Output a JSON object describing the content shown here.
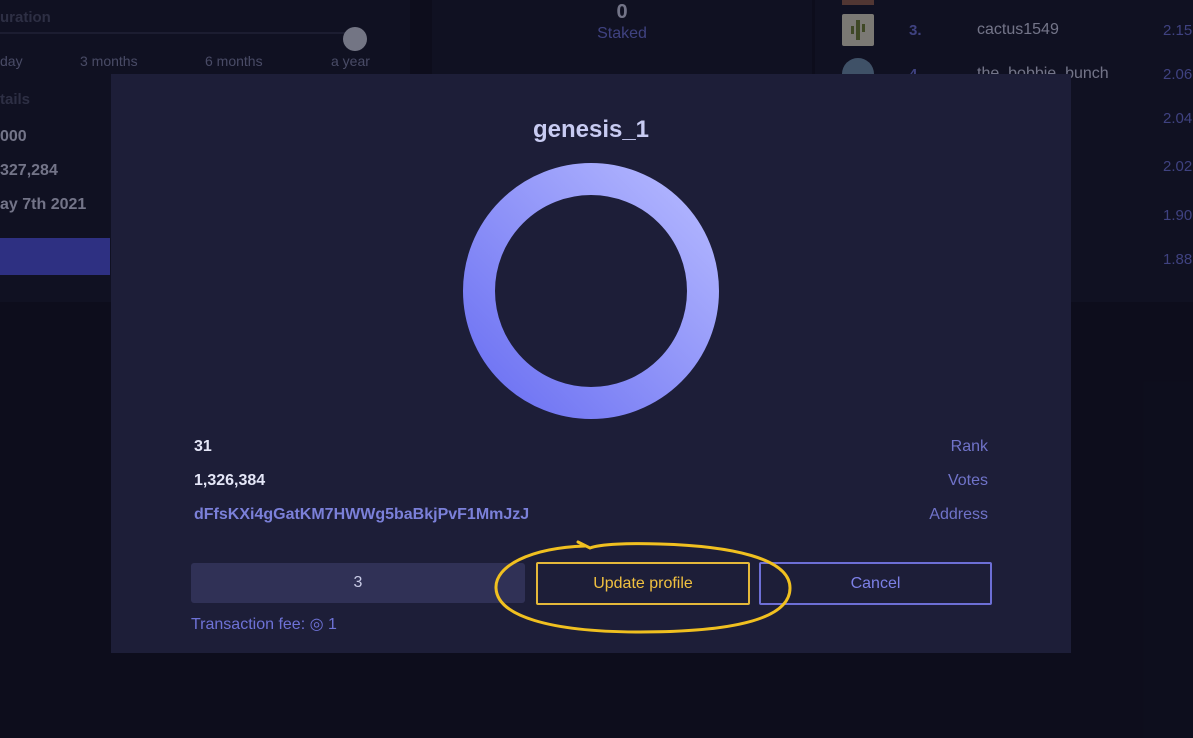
{
  "background": {
    "duration_label": "uration",
    "durations": [
      "day",
      "3 months",
      "6 months",
      "a year"
    ],
    "details_label": "tails",
    "details": [
      "000",
      "327,284",
      "ay 7th 2021"
    ],
    "staked_value": "0",
    "staked_label": "Staked",
    "leaderboard": [
      {
        "rank": "3.",
        "name": "cactus1549",
        "value": "2.15"
      },
      {
        "rank": "4.",
        "name": "the_bobbie_bunch",
        "value": "2.06"
      },
      {
        "rank": "",
        "name": "",
        "value": "2.04"
      },
      {
        "rank": "",
        "name": "",
        "value": "2.02"
      },
      {
        "rank": "",
        "name": "",
        "value": "1.90"
      },
      {
        "rank": "",
        "name": "",
        "value": "1.88"
      }
    ]
  },
  "modal": {
    "title": "genesis_1",
    "rows": [
      {
        "value": "31",
        "label": "Rank"
      },
      {
        "value": "1,326,384",
        "label": "Votes"
      },
      {
        "value": "dFfsKXi4gGatKM7HWWg5baBkjPvF1MmJzJ",
        "label": "Address"
      }
    ],
    "input_value": "3",
    "update_label": "Update profile",
    "cancel_label": "Cancel",
    "fee_text": "Transaction fee: ◎ 1"
  },
  "colors": {
    "accent": "#6b6ff0",
    "highlight": "#f0c020"
  },
  "icons": {
    "avatar_3": "cactus-avatar",
    "avatar_4": "avatar"
  }
}
